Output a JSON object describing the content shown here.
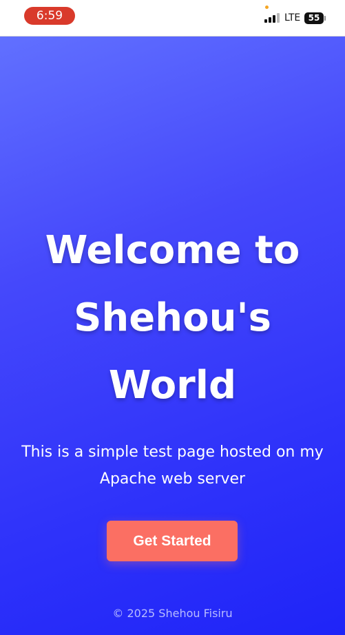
{
  "status_bar": {
    "time": "6:59",
    "network": "LTE",
    "battery": "55",
    "signal_icon": "cellular-signal-icon",
    "battery_icon": "battery-icon"
  },
  "hero": {
    "title_line1": "Welcome to",
    "title_line2": "Shehou's",
    "title_line3": "World",
    "subtitle_line1": "This is a simple test page hosted on my",
    "subtitle_line2": "Apache web server",
    "cta_label": "Get Started"
  },
  "footer": {
    "text": "© 2025 Shehou Fisiru"
  },
  "colors": {
    "hero_gradient_start": "#6170ff",
    "hero_gradient_end": "#1f24f8",
    "cta_background": "#fb6f63",
    "time_pill": "#d93a2b"
  }
}
